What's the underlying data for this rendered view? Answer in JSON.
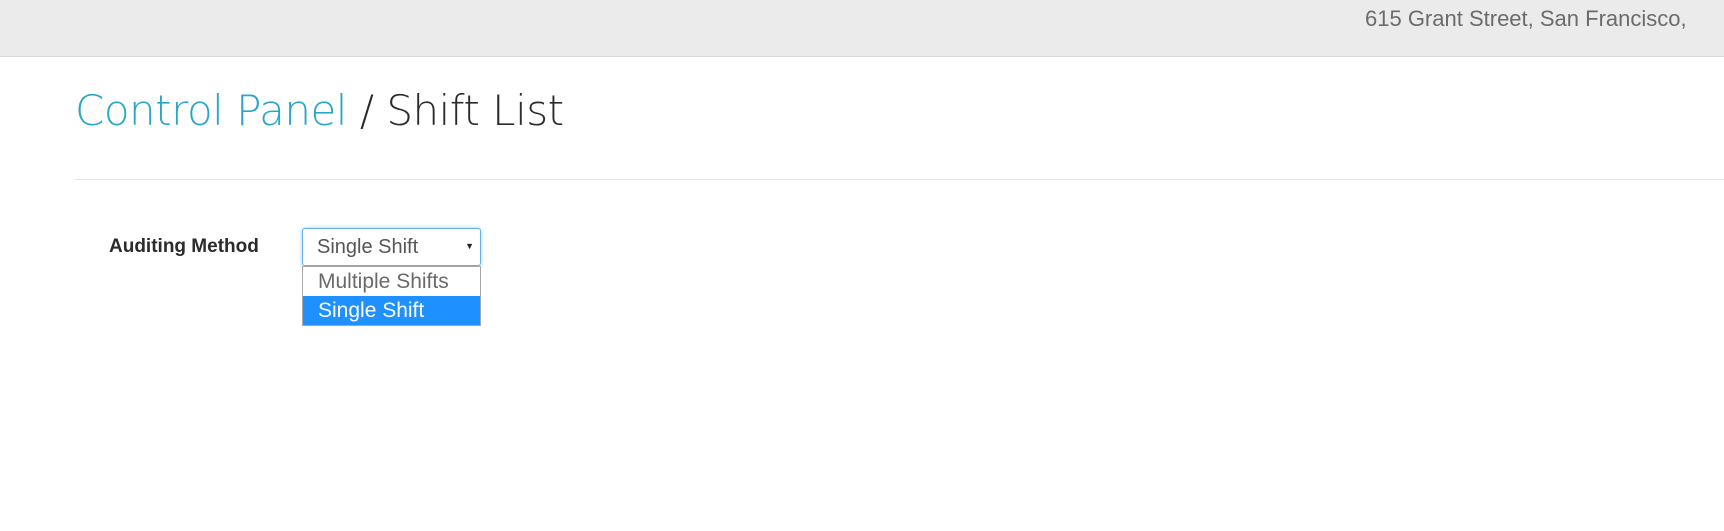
{
  "header": {
    "address": "615 Grant Street, San Francisco,"
  },
  "breadcrumb": {
    "parent_label": "Control Panel",
    "separator": "/",
    "current_label": "Shift List"
  },
  "form": {
    "auditing_method": {
      "label": "Auditing Method",
      "selected_value": "Single Shift",
      "options": [
        "Multiple Shifts",
        "Single Shift"
      ]
    }
  },
  "colors": {
    "link": "#2aa7c7",
    "highlight": "#1e90ff",
    "topbar": "#ebebeb"
  }
}
